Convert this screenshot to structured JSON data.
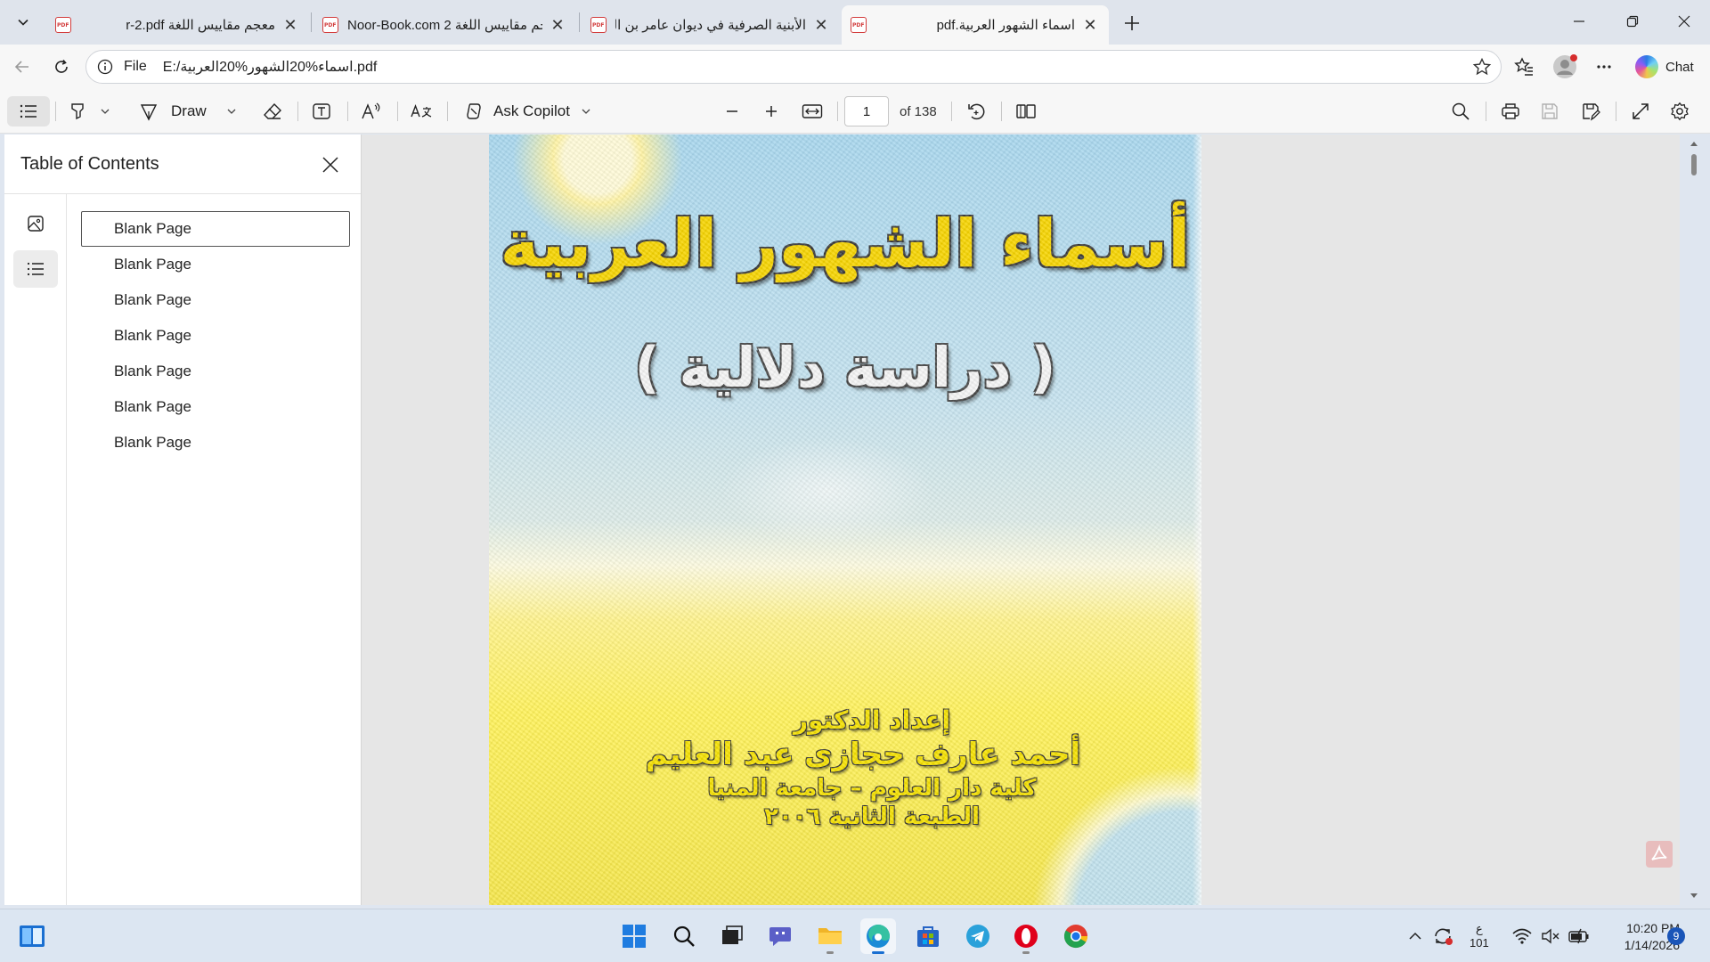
{
  "tabs": [
    {
      "title": "معجم مقاييس اللغة r-2.pdf"
    },
    {
      "title": "Noor-Book.com 2 معجم مقاييس اللغة"
    },
    {
      "title": "الأبنية الصرفية في ديوان عامر بن الطفيل"
    },
    {
      "title": "اسماء الشهور العربية.pdf"
    }
  ],
  "address_bar": {
    "scheme": "File",
    "url": "E:/اسماء%20الشهور%20العربية.pdf"
  },
  "chat_label": "Chat",
  "pdf_toolbar": {
    "draw_label": "Draw",
    "ask_copilot_label": "Ask Copilot",
    "page_number": "1",
    "page_count": "of 138"
  },
  "side_panel": {
    "title": "Table of Contents",
    "items": [
      "Blank Page",
      "Blank Page",
      "Blank Page",
      "Blank Page",
      "Blank Page",
      "Blank Page",
      "Blank Page"
    ]
  },
  "cover": {
    "title": "أسماء الشهور العربية",
    "subtitle": "( دراسة دلالية )",
    "prepared_by": "إعداد الدكتور",
    "author": "أحمد عارف حجازى عبد العليم",
    "affiliation": "كلية دار العلوم – جامعة المنيا",
    "edition": "الطبعة الثانية ٢٠٠٦"
  },
  "taskbar": {
    "input_lang": "ع",
    "input_sub": "101",
    "time": "10:20 PM",
    "date": "1/14/2026",
    "notification_count": "9"
  }
}
